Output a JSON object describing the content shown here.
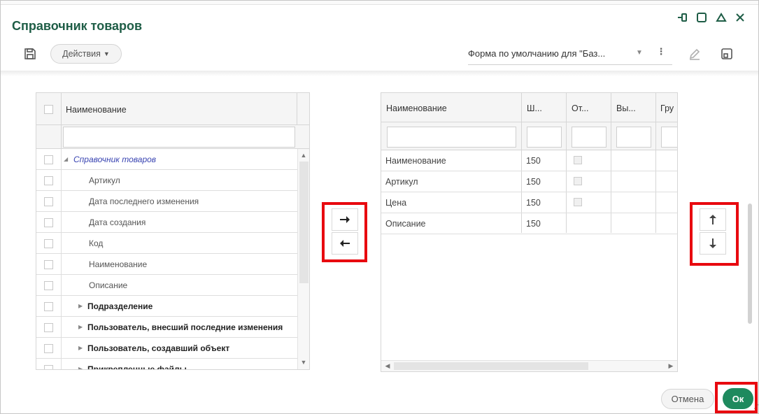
{
  "window": {
    "title": "Справочник товаров"
  },
  "toolbar": {
    "save_icon": "save-icon",
    "actions_label": "Действия",
    "form_select_value": "Форма по умолчанию для \"Баз...",
    "edit_icon": "pencil-icon",
    "layout_icon": "layout-icon"
  },
  "left_grid": {
    "header": "Наименование",
    "filter_value": "",
    "rows": [
      {
        "label": "Справочник товаров",
        "type": "root"
      },
      {
        "label": "Артикул",
        "type": "leaf"
      },
      {
        "label": "Дата последнего изменения",
        "type": "leaf"
      },
      {
        "label": "Дата создания",
        "type": "leaf"
      },
      {
        "label": "Код",
        "type": "leaf"
      },
      {
        "label": "Наименование",
        "type": "leaf"
      },
      {
        "label": "Описание",
        "type": "leaf"
      },
      {
        "label": "Подразделение",
        "type": "group"
      },
      {
        "label": "Пользователь, внесший последние изменения",
        "type": "group"
      },
      {
        "label": "Пользователь, создавший объект",
        "type": "group"
      },
      {
        "label": "Прикрепленные файлы",
        "type": "group"
      }
    ]
  },
  "transfer": {
    "add_icon": "arrow-right-icon",
    "remove_icon": "arrow-left-icon"
  },
  "right_grid": {
    "columns": [
      "Наименование",
      "Ш...",
      "От...",
      "Вы...",
      "Гру"
    ],
    "rows": [
      {
        "name": "Наименование",
        "width": "150",
        "checkbox": true
      },
      {
        "name": "Артикул",
        "width": "150",
        "checkbox": true
      },
      {
        "name": "Цена",
        "width": "150",
        "checkbox": true
      },
      {
        "name": "Описание",
        "width": "150",
        "checkbox": false
      }
    ]
  },
  "order": {
    "up_icon": "arrow-up-icon",
    "down_icon": "arrow-down-icon"
  },
  "footer": {
    "cancel_label": "Отмена",
    "ok_label": "Ок"
  },
  "colors": {
    "title": "#1e5d46",
    "ok_button": "#1e8a5e",
    "highlight": "#e8090f",
    "root_link": "#3a45b2"
  }
}
